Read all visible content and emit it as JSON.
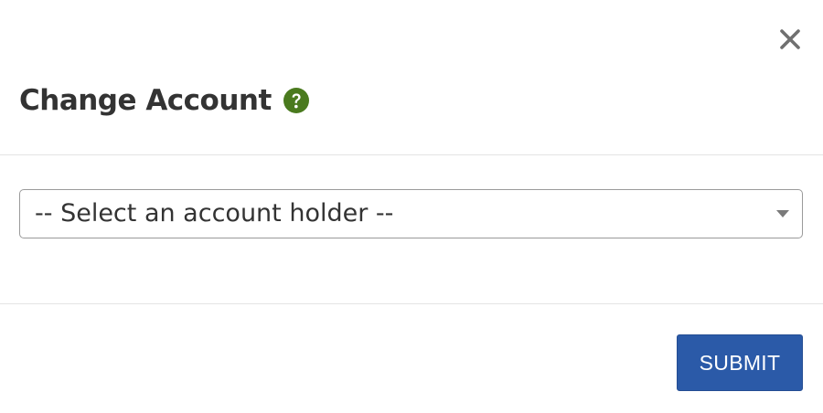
{
  "dialog": {
    "title": "Change Account"
  },
  "select": {
    "value": "-- Select an account holder --"
  },
  "footer": {
    "submit_label": "SUBMIT"
  },
  "icons": {
    "close": "close-icon",
    "help": "help-icon",
    "caret": "chevron-down-icon"
  },
  "colors": {
    "help_icon": "#4a7a1e",
    "submit_background": "#2b5aa8",
    "close_icon": "#707070"
  }
}
